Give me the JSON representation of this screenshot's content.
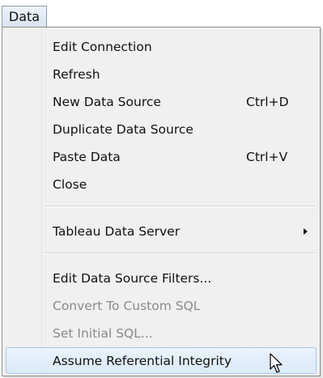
{
  "menubar": {
    "title": "Data"
  },
  "menu": {
    "items": [
      {
        "label": "Edit Connection",
        "shortcut": "",
        "enabled": true
      },
      {
        "label": "Refresh",
        "shortcut": "",
        "enabled": true
      },
      {
        "label": "New Data Source",
        "shortcut": "Ctrl+D",
        "enabled": true
      },
      {
        "label": "Duplicate Data Source",
        "shortcut": "",
        "enabled": true
      },
      {
        "label": "Paste Data",
        "shortcut": "Ctrl+V",
        "enabled": true
      },
      {
        "label": "Close",
        "shortcut": "",
        "enabled": true
      },
      {
        "label": "Tableau Data Server",
        "shortcut": "",
        "enabled": true,
        "submenu": true
      },
      {
        "label": "Edit Data Source Filters...",
        "shortcut": "",
        "enabled": true
      },
      {
        "label": "Convert To Custom SQL",
        "shortcut": "",
        "enabled": false
      },
      {
        "label": "Set Initial SQL...",
        "shortcut": "",
        "enabled": false
      },
      {
        "label": "Assume Referential Integrity",
        "shortcut": "",
        "enabled": true,
        "highlighted": true
      }
    ]
  },
  "colors": {
    "menu_background": "#f0f0f0",
    "highlight_border": "#a8c8ee",
    "disabled_text": "#8a8a8a"
  }
}
